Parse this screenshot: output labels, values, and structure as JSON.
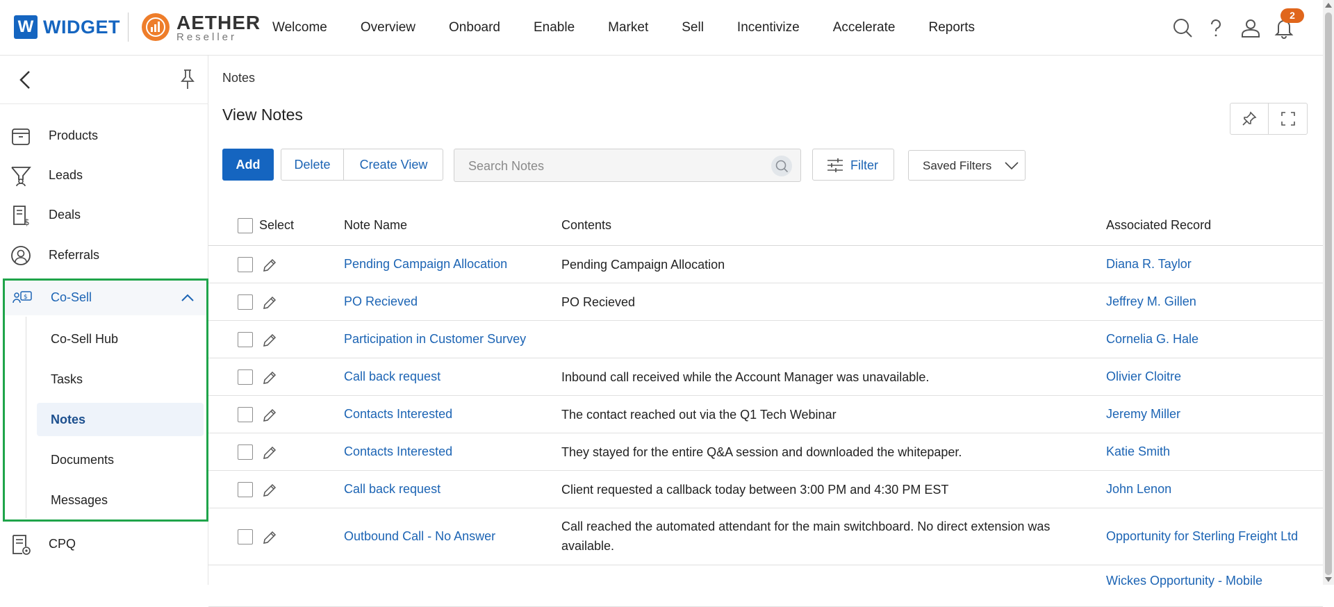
{
  "brand": {
    "widget_letter": "W",
    "widget_name": "WIDGET",
    "aether_name": "AETHER",
    "aether_sub": "Reseller"
  },
  "nav": [
    "Welcome",
    "Overview",
    "Onboard",
    "Enable",
    "Market",
    "Sell",
    "Incentivize",
    "Accelerate",
    "Reports"
  ],
  "notifications_count": "2",
  "sidebar": {
    "items": [
      {
        "label": "Products",
        "icon": "box-icon"
      },
      {
        "label": "Leads",
        "icon": "funnel-icon"
      },
      {
        "label": "Deals",
        "icon": "deal-document-icon"
      },
      {
        "label": "Referrals",
        "icon": "referral-icon"
      }
    ],
    "cosell": {
      "label": "Co-Sell",
      "icon": "co-sell-icon",
      "sub": [
        "Co-Sell Hub",
        "Tasks",
        "Notes",
        "Documents",
        "Messages"
      ],
      "active": "Notes"
    },
    "cpq": {
      "label": "CPQ",
      "icon": "cpq-icon"
    }
  },
  "main": {
    "breadcrumb": "Notes",
    "title": "View Notes",
    "add_label": "Add",
    "delete_label": "Delete",
    "create_view_label": "Create View",
    "search_placeholder": "Search Notes",
    "filter_label": "Filter",
    "saved_filters_label": "Saved Filters"
  },
  "table": {
    "headers": {
      "select": "Select",
      "name": "Note Name",
      "contents": "Contents",
      "record": "Associated Record"
    },
    "rows": [
      {
        "name": "Pending Campaign Allocation",
        "contents": "Pending Campaign Allocation",
        "record": "Diana R. Taylor"
      },
      {
        "name": "PO Recieved",
        "contents": "PO Recieved",
        "record": "Jeffrey M. Gillen"
      },
      {
        "name": "Participation in Customer Survey",
        "contents": "",
        "record": "Cornelia G. Hale"
      },
      {
        "name": "Call back request",
        "contents": "Inbound call received while the Account Manager was unavailable.",
        "record": "Olivier Cloitre"
      },
      {
        "name": "Contacts Interested",
        "contents": "The contact reached out via the Q1 Tech Webinar",
        "record": "Jeremy Miller"
      },
      {
        "name": "Contacts Interested",
        "contents": "They stayed for the entire Q&A session and downloaded the whitepaper.",
        "record": "Katie Smith"
      },
      {
        "name": "Call back request",
        "contents": "Client requested a callback today between 3:00 PM and 4:30 PM EST",
        "record": "John Lenon"
      },
      {
        "name": "Outbound Call - No Answer",
        "contents": "Call reached the automated attendant for the main switchboard. No direct extension was available.",
        "record": "Opportunity for Sterling Freight Ltd"
      },
      {
        "name": "",
        "contents": "",
        "record": "Wickes Opportunity - Mobile"
      }
    ]
  },
  "colors": {
    "accent": "#1565c0",
    "link": "#1c64b4",
    "badge": "#e0661c",
    "highlight_border": "#1fa44a"
  }
}
